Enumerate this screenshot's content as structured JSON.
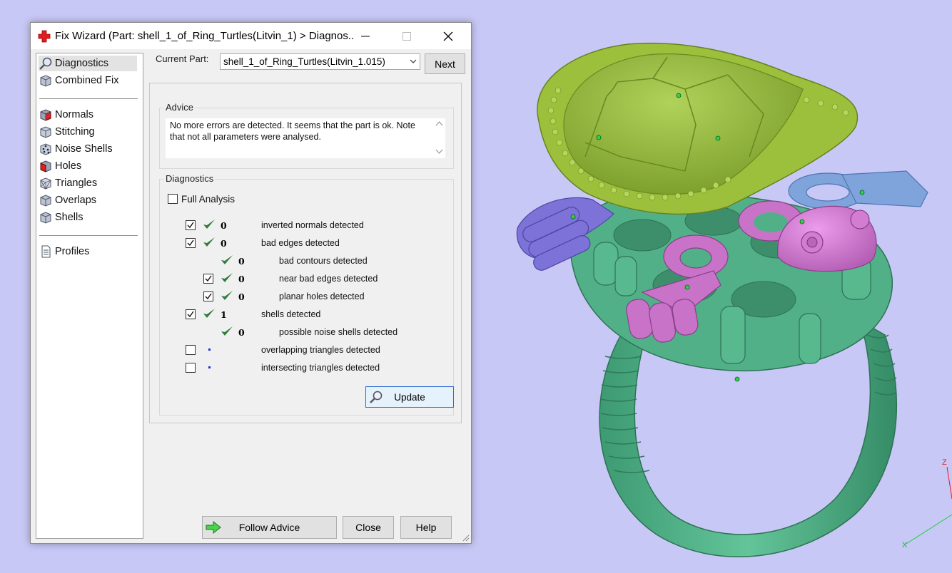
{
  "window": {
    "title": "Fix Wizard (Part: shell_1_of_Ring_Turtles(Litvin_1) > Diagnos..."
  },
  "nav": {
    "items": [
      {
        "label": "Diagnostics",
        "icon": "magnifier-icon"
      },
      {
        "label": "Combined Fix",
        "icon": "cube-icon"
      },
      {
        "label": "Normals",
        "icon": "red-cube-icon"
      },
      {
        "label": "Stitching",
        "icon": "cube-icon"
      },
      {
        "label": "Noise Shells",
        "icon": "dotted-cube-icon"
      },
      {
        "label": "Holes",
        "icon": "red-cube-icon"
      },
      {
        "label": "Triangles",
        "icon": "wire-cube-icon"
      },
      {
        "label": "Overlaps",
        "icon": "cube-icon"
      },
      {
        "label": "Shells",
        "icon": "cube-icon"
      },
      {
        "label": "Profiles",
        "icon": "document-icon"
      }
    ]
  },
  "top": {
    "current_part_label": "Current Part:",
    "current_part_value": "shell_1_of_Ring_Turtles(Litvin_1.015)",
    "next_label": "Next"
  },
  "advice": {
    "title": "Advice",
    "text": "No more errors are detected. It seems that the part is ok. Note that not all parameters were analysed."
  },
  "diagnostics": {
    "title": "Diagnostics",
    "full_analysis_label": "Full Analysis",
    "rows": [
      {
        "label": "inverted normals detected",
        "count": "0",
        "checked": true,
        "level": 0
      },
      {
        "label": "bad edges detected",
        "count": "0",
        "checked": true,
        "level": 0
      },
      {
        "label": "bad contours detected",
        "count": "0",
        "checked": null,
        "level": 1
      },
      {
        "label": "near bad edges detected",
        "count": "0",
        "checked": true,
        "level": 1
      },
      {
        "label": "planar holes detected",
        "count": "0",
        "checked": true,
        "level": 1
      },
      {
        "label": "shells detected",
        "count": "1",
        "checked": true,
        "level": 0
      },
      {
        "label": "possible noise shells detected",
        "count": "0",
        "checked": null,
        "level": 1
      },
      {
        "label": "overlapping triangles detected",
        "count": "",
        "checked": false,
        "level": 0
      },
      {
        "label": "intersecting triangles detected",
        "count": "",
        "checked": false,
        "level": 0
      }
    ],
    "update_label": "Update"
  },
  "buttons": {
    "follow_advice": "Follow Advice",
    "close": "Close",
    "help": "Help"
  },
  "viewport": {
    "axis_z": "Z",
    "axis_x": "X"
  },
  "colors": {
    "background": "#c8c8f6",
    "ring_green": "#4fae86",
    "shell_yellow": "#9cbf3c",
    "magenta": "#c873c8",
    "violet": "#7c72d8",
    "blue": "#7fa4dc",
    "check_green": "#2f7d3a"
  }
}
